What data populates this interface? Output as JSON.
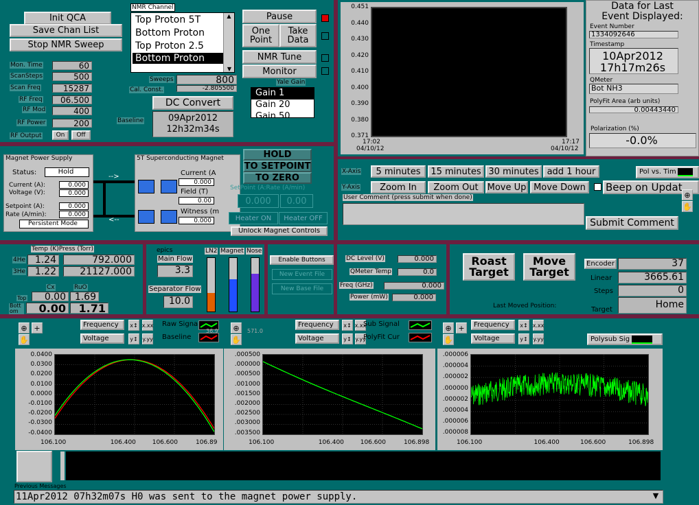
{
  "top_buttons": {
    "init_qca": "Init QCA",
    "save_chan_list": "Save Chan List",
    "stop_nmr_sweep": "Stop NMR Sweep"
  },
  "nmr_channel": {
    "title": "NMR Channel",
    "items": [
      "Top Proton 5T",
      "Bottom Proton",
      "Top Proton 2.5",
      "Bottom Proton"
    ],
    "selected_index": 3
  },
  "params": {
    "mon_time": {
      "label": "Mon. Time",
      "value": "60"
    },
    "scan_steps": {
      "label": "ScanSteps",
      "value": "500"
    },
    "scan_freq": {
      "label": "Scan Freq",
      "value": "15287"
    },
    "rf_freq": {
      "label": "RF Freq",
      "value": "06.500"
    },
    "rf_mod": {
      "label": "RF Mod",
      "value": "400"
    },
    "rf_power": {
      "label": "RF Power",
      "value": "200"
    },
    "rf_output": {
      "label": "RF Output",
      "on": "On",
      "off": "Off"
    }
  },
  "sweeps": {
    "label": "Sweeps",
    "value": "800"
  },
  "cal_const": {
    "label": "Cal. Const.",
    "value": "-2.805500"
  },
  "control_buttons": {
    "pause": "Pause",
    "one_point_1": "One",
    "one_point_2": "Point",
    "take_data_1": "Take",
    "take_data_2": "Data",
    "nmr_tune": "NMR Tune",
    "monitor": "Monitor"
  },
  "yale_gain": {
    "label": "Yale Gain",
    "items": [
      "Gain 1",
      "Gain 20",
      "Gain 50"
    ],
    "selected_index": 0
  },
  "dc_convert": "DC Convert",
  "baseline": {
    "label": "Baseline",
    "date": "09Apr2012",
    "time": "12h32m34s"
  },
  "main_plot": {
    "yticks": [
      "0.451",
      "0.440",
      "0.430",
      "0.420",
      "0.410",
      "0.400",
      "0.390",
      "0.380",
      "0.371"
    ],
    "x_left_time": "17:02",
    "x_left_date": "04/10/12",
    "x_right_time": "17:17",
    "x_right_date": "04/10/12"
  },
  "last_event": {
    "title1": "Data for Last",
    "title2": "Event Displayed:",
    "event_number_label": "Event Number",
    "event_number": "1334092646",
    "timestamp_label": "Timestamp",
    "ts_date": "10Apr2012",
    "ts_time": "17h17m26s",
    "qmeter_label": "QMeter",
    "qmeter": "Bot NH3",
    "polyfit_label": "PolyFit Area (arb units)",
    "polyfit": "0.00443440",
    "polarization_label": "Polarization (%)",
    "polarization": "-0.0%"
  },
  "x_axis": {
    "label": "X-Axis",
    "buttons": [
      "5 minutes",
      "15 minutes",
      "30 minutes",
      "add 1 hour"
    ]
  },
  "y_axis": {
    "label": "Y-Axis",
    "buttons": [
      "Zoom In",
      "Zoom Out",
      "Move Up",
      "Move Down"
    ]
  },
  "pol_vs_time": "Pol vs. Tim",
  "beep_on_update": "Beep on Updat",
  "user_comment": {
    "label": "User Comment (press submit when done)",
    "value": "",
    "submit": "Submit Comment"
  },
  "magnet_power_supply": {
    "title": "Magnet Power Supply",
    "status_label": "Status:",
    "status": "Hold",
    "current_label": "Current (A):",
    "current": "0.000",
    "voltage_label": "Voltage (V):",
    "voltage": "0.000",
    "setpoint_label": "Setpoint (A):",
    "setpoint": "0.000",
    "rate_label": "Rate (A/min):",
    "rate": "0.000",
    "mode": "Persistent Mode"
  },
  "sc_magnet": {
    "title": "5T Superconducting Magnet",
    "current_label": "Current (A",
    "current": "0.000",
    "field_label": "Field (T)",
    "field": "0.00",
    "witness_label": "Witness (m",
    "witness": "0.000"
  },
  "magnet_controls": {
    "hold": "HOLD",
    "to_setpoint": "TO SETPOINT",
    "to_zero": "TO ZERO",
    "setpoint_rate_label": "SetPoint (A:Rate (A/min)",
    "setpoint": "0.000",
    "rate": "0.00",
    "heater_on": "Heater ON",
    "heater_off": "Heater OFF",
    "unlock": "Unlock Magnet Controls"
  },
  "temp": {
    "title": "Temp (K)Press (Torr)",
    "he4_label": "4He",
    "he4_temp": "1.24",
    "he4_press": "792.000",
    "he3_label": "3He",
    "he3_temp": "1.22",
    "he3_press": "21127.000",
    "cx_label": "Cx",
    "ruo_label": "RuO",
    "top_label": "Top",
    "top_cx": "0.00",
    "top_ruo": "1.69",
    "bottom_label": "Bott om",
    "bottom_cx": "0.00",
    "bottom_ruo": "1.71"
  },
  "flows": {
    "epics": "epics",
    "main_flow_label": "Main Flow",
    "main_flow": "3.3",
    "separator_flow_label": "Separator Flow",
    "separator_flow": "10.0"
  },
  "levels": {
    "ln2": "LN2",
    "magnet": "Magnet",
    "nose": "Nose",
    "ln2_level": 0.35,
    "magnet_level": 0.6,
    "nose_level": 0.7
  },
  "file_buttons": {
    "enable": "Enable Buttons",
    "new_event": "New Event File",
    "new_base": "New Base File"
  },
  "dc": {
    "dc_level_label": "DC Level (V)",
    "dc_level": "0.000",
    "qmeter_temp_label": "QMeter Temp",
    "qmeter_temp": "0.0",
    "freq_label": "Freq (GHz)",
    "freq": "0.000",
    "power_label": "Power (mW)",
    "power": "0.000"
  },
  "target": {
    "roast_1": "Roast",
    "roast_2": "Target",
    "move_1": "Move",
    "move_2": "Target",
    "last_moved": "Last Moved Position:",
    "encoder_label": "Encoder",
    "encoder": "37",
    "linear_label": "Linear",
    "linear": "3665.61",
    "steps_label": "Steps",
    "steps": "0",
    "target_label": "Target",
    "target": "Home"
  },
  "plot1": {
    "frequency": "Frequency",
    "voltage": "Voltage",
    "raw_signal": "Raw Signa",
    "baseline": "Baseline",
    "yticks": [
      "0.0400",
      "0.0300",
      "0.0200",
      "0.0100",
      "0.0000",
      "-0.0100",
      "-0.0200",
      "-0.0300",
      "-0.0400"
    ],
    "xticks": [
      "106.100",
      "106.400",
      "106.600",
      "106.89"
    ]
  },
  "plot2": {
    "frequency": "Frequency",
    "voltage": "Voltage",
    "sub_signal": "Sub Signal",
    "polyfit": "PolyFit Cur",
    "readout_a": "36.9",
    "readout_b": "571.0",
    "yticks": [
      ".000500",
      ".000000",
      ".000500",
      ".001000",
      ".001500",
      ".002000",
      ".002500",
      ".003000",
      ".003500"
    ],
    "xticks": [
      "106.100",
      "106.400",
      "106.600",
      "106.898"
    ]
  },
  "plot3": {
    "frequency": "Frequency",
    "voltage": "Voltage",
    "polysub": "Polysub Sig",
    "yticks": [
      ".000006",
      ".000004",
      ".000002",
      ".000000",
      ".000002",
      ".000004",
      ".000006",
      ".000008"
    ],
    "xticks": [
      "106.100",
      "106.400",
      "106.600",
      "106.898"
    ]
  },
  "messages": {
    "label": "Previous Messages",
    "text": "11Apr2012 07h32m07s H0 was sent to the magnet power supply."
  },
  "colors": {
    "bg": "#006b6b",
    "separator": "#6b1f3f",
    "raw": "#00ff00",
    "baseline": "#ff0000",
    "sub": "#00ff00"
  }
}
